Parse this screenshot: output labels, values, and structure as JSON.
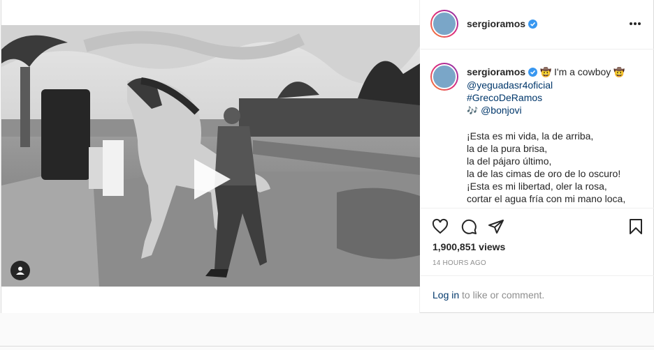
{
  "post": {
    "username": "sergioramos",
    "more_icon": "more-options-icon",
    "verified_icon": "verified-badge-icon"
  },
  "caption": {
    "username": "sergioramos",
    "title_text": "I'm a cowboy",
    "cowboy_emoji": "🤠",
    "mention_farm": "@yeguadasr4oficial",
    "hashtag": "#GrecoDeRamos",
    "music_emoji": "🎶",
    "mention_bonjovi": "@bonjovi",
    "poem": [
      "¡Esta es mi vida, la de arriba,",
      "la de la pura brisa,",
      "la del pájaro último,",
      "la de las cimas de oro de lo oscuro!",
      "¡Esta es mi libertad, oler la rosa,",
      "cortar el agua fría con mi mano loca,"
    ]
  },
  "actions": {
    "views": "1,900,851 views",
    "time": "14 HOURS AGO",
    "icons": [
      "heart-icon",
      "comment-icon",
      "share-icon",
      "bookmark-icon"
    ]
  },
  "login": {
    "link": "Log in",
    "rest": " to like or comment."
  },
  "colors": {
    "text": "#262626",
    "link": "#00376b",
    "muted": "#8e8e8e",
    "verified": "#3897f0",
    "border": "#dbdbdb"
  }
}
